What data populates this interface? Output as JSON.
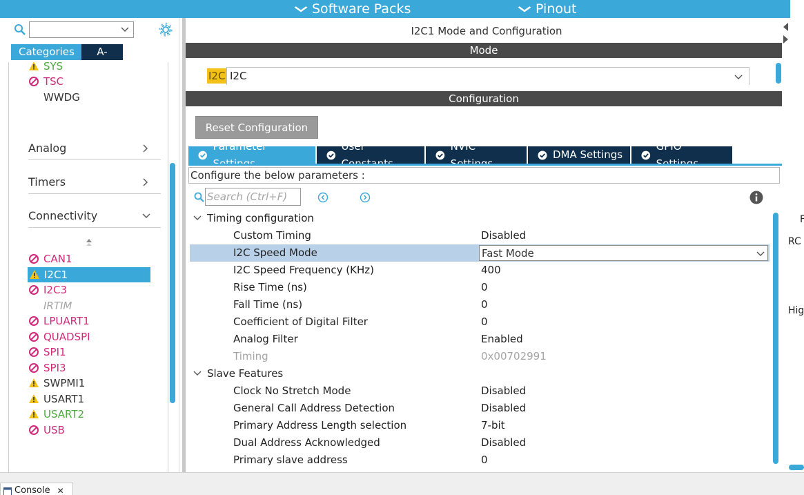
{
  "topbar": {
    "software_packs": "Software Packs",
    "pinout": "Pinout"
  },
  "sidebar": {
    "search_value": "",
    "tabs": {
      "categories": "Categories",
      "az": "A->Z"
    },
    "system_items": [
      {
        "label": "SYS",
        "status": "warning",
        "color": "green"
      },
      {
        "label": "TSC",
        "status": "disabled",
        "color": "pink"
      },
      {
        "label": "WWDG",
        "status": "none",
        "color": "dark"
      }
    ],
    "categories": {
      "analog": "Analog",
      "timers": "Timers",
      "connectivity": "Connectivity"
    },
    "connectivity_items": [
      {
        "label": "CAN1",
        "status": "disabled",
        "color": "pink"
      },
      {
        "label": "I2C1",
        "status": "warning",
        "color": "selected"
      },
      {
        "label": "I2C3",
        "status": "disabled",
        "color": "pink"
      },
      {
        "label": "IRTIM",
        "status": "none",
        "color": "grey"
      },
      {
        "label": "LPUART1",
        "status": "disabled",
        "color": "pink"
      },
      {
        "label": "QUADSPI",
        "status": "disabled",
        "color": "pink"
      },
      {
        "label": "SPI1",
        "status": "disabled",
        "color": "pink"
      },
      {
        "label": "SPI3",
        "status": "disabled",
        "color": "pink"
      },
      {
        "label": "SWPMI1",
        "status": "warning",
        "color": "dark"
      },
      {
        "label": "USART1",
        "status": "warning",
        "color": "dark"
      },
      {
        "label": "USART2",
        "status": "warning",
        "color": "green"
      },
      {
        "label": "USB",
        "status": "disabled",
        "color": "pink"
      }
    ]
  },
  "main": {
    "title": "I2C1 Mode and Configuration",
    "mode_band": "Mode",
    "mode_badge": "I2C",
    "mode_value": "I2C",
    "config_band": "Configuration",
    "reset_button": "Reset Configuration",
    "tabs": [
      {
        "label": "Parameter Settings",
        "active": true
      },
      {
        "label": "User Constants",
        "active": false
      },
      {
        "label": "NVIC Settings",
        "active": false
      },
      {
        "label": "DMA Settings",
        "active": false
      },
      {
        "label": "GPIO Settings",
        "active": false
      }
    ],
    "description": "Configure the below parameters :",
    "search_placeholder": "Search (Ctrl+F)",
    "sections": {
      "timing": "Timing configuration",
      "slave": "Slave Features"
    },
    "timing_params": [
      {
        "name": "Custom Timing",
        "value": "Disabled"
      },
      {
        "name": "I2C Speed Mode",
        "value": "Fast Mode"
      },
      {
        "name": "I2C Speed Frequency (KHz)",
        "value": "400"
      },
      {
        "name": "Rise Time (ns)",
        "value": "0"
      },
      {
        "name": "Fall Time (ns)",
        "value": "0"
      },
      {
        "name": "Coefficient of Digital Filter",
        "value": "0"
      },
      {
        "name": "Analog Filter",
        "value": "Enabled"
      },
      {
        "name": "Timing",
        "value": "0x00702991"
      }
    ],
    "slave_params": [
      {
        "name": "Clock No Stretch Mode",
        "value": "Disabled"
      },
      {
        "name": "General Call Address Detection",
        "value": "Disabled"
      },
      {
        "name": "Primary Address Length selection",
        "value": "7-bit"
      },
      {
        "name": "Dual Address Acknowledged",
        "value": "Disabled"
      },
      {
        "name": "Primary slave address",
        "value": "0"
      }
    ]
  },
  "right_panel": {
    "text_f": "F",
    "text_rc": "RC",
    "text_high": "High"
  },
  "bottom": {
    "console_tab": "Console"
  },
  "colors": {
    "accent": "#3aa8d8",
    "navy": "#0f2f4d",
    "disabled_pink": "#d1287a",
    "ok_green": "#4caa3c",
    "warning_yellow": "#f2c218"
  }
}
